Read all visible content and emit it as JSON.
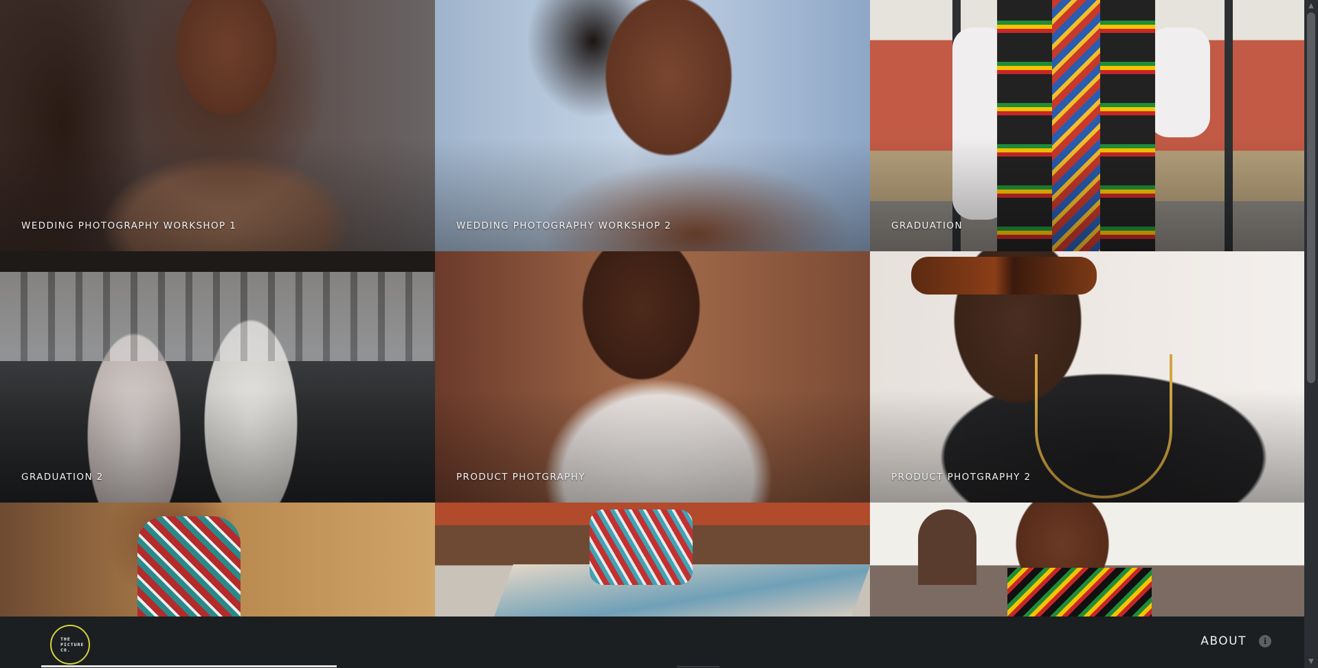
{
  "gallery": {
    "items": [
      {
        "caption": "WEDDING PHOTOGRAPHY WORKSHOP 1"
      },
      {
        "caption": "WEDDING PHOTOGRAPHY WORKSHOP 2"
      },
      {
        "caption": "GRADUATION"
      },
      {
        "caption": "GRADUATION 2"
      },
      {
        "caption": "PRODUCT PHOTGRAPHY"
      },
      {
        "caption": "PRODUCT PHOTGRAPHY 2"
      },
      {
        "caption": ""
      },
      {
        "caption": ""
      },
      {
        "caption": ""
      }
    ]
  },
  "footer": {
    "logo": {
      "line1": "THE",
      "line2": "PICTURE",
      "line3": "CO."
    },
    "about_label": "ABOUT",
    "info_icon": "i"
  },
  "colors": {
    "accent": "#d9d33a",
    "background": "#1b1f22"
  }
}
